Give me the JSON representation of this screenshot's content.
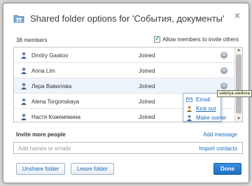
{
  "dialog": {
    "title": "Shared folder options for 'События, документы'",
    "close_glyph": "×"
  },
  "members": {
    "count_label": "38 members",
    "allow_invite_label": "Allow members to invite others",
    "allow_invite_checked": true,
    "rows": [
      {
        "name": "Dmitry Gaskov",
        "status": "Joined"
      },
      {
        "name": "Anna Lim",
        "status": "Joined"
      },
      {
        "name": "Лера Вавилова",
        "status": "Joined"
      },
      {
        "name": "Alena Torgonskaya",
        "status": "Joined"
      },
      {
        "name": "Настя Кожемякина",
        "status": "Joined"
      }
    ]
  },
  "context_menu": {
    "items": [
      {
        "label": "Email",
        "icon": "envelope-icon"
      },
      {
        "label": "Kick out",
        "icon": "user-icon"
      },
      {
        "label": "Make owner",
        "icon": "user-icon"
      }
    ]
  },
  "tooltip": {
    "text": "valeriya.vavilova"
  },
  "invite": {
    "heading": "Invite more people",
    "add_message_label": "Add message",
    "input_placeholder": "Add names or emails",
    "import_contacts_label": "Import contacts"
  },
  "buttons": {
    "unshare": "Unshare folder",
    "leave": "Leave folder",
    "done": "Done"
  },
  "colors": {
    "accent": "#1e6bb8",
    "done_button": "#2a7ad0"
  }
}
